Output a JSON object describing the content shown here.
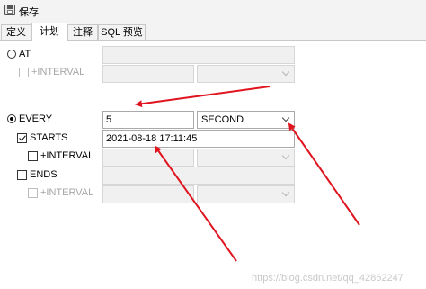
{
  "toolbar": {
    "save_label": "保存"
  },
  "tabs": [
    {
      "label": "定义"
    },
    {
      "label": "计划",
      "active": true
    },
    {
      "label": "注释"
    },
    {
      "label": "SQL 预览"
    }
  ],
  "schedule": {
    "at": {
      "label": "AT",
      "selected": false,
      "interval_label": "+INTERVAL",
      "interval_checked": false
    },
    "every": {
      "label": "EVERY",
      "selected": true,
      "value": "5",
      "unit": "SECOND"
    },
    "starts": {
      "label": "STARTS",
      "checked": true,
      "value": "2021-08-18 17:11:45",
      "interval_label": "+INTERVAL",
      "interval_checked": false
    },
    "ends": {
      "label": "ENDS",
      "checked": false,
      "interval_label": "+INTERVAL",
      "interval_checked": false
    }
  },
  "annotations": {
    "arrow_color": "#e0141e"
  },
  "watermark": "https://blog.csdn.net/qq_42862247"
}
